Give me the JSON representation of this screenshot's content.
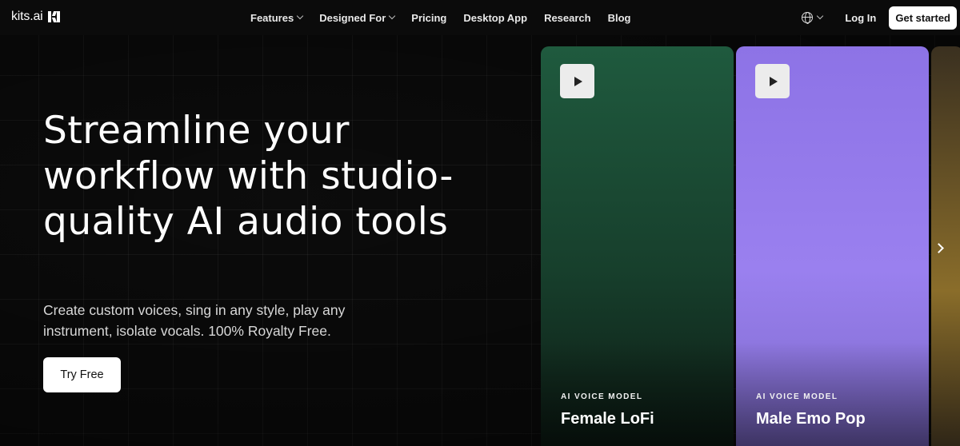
{
  "brand": {
    "name": "kits.ai"
  },
  "nav": {
    "links": [
      {
        "label": "Features",
        "dropdown": true
      },
      {
        "label": "Designed For",
        "dropdown": true
      },
      {
        "label": "Pricing",
        "dropdown": false
      },
      {
        "label": "Desktop App",
        "dropdown": false
      },
      {
        "label": "Research",
        "dropdown": false
      },
      {
        "label": "Blog",
        "dropdown": false
      }
    ],
    "language_icon": "globe-icon",
    "login_label": "Log In",
    "cta_label": "Get started"
  },
  "hero": {
    "title": "Streamline your workflow with studio-quality AI audio tools",
    "subtitle": "Create custom voices, sing in any style, play any instrument, isolate vocals. 100% Royalty Free.",
    "cta_label": "Try Free"
  },
  "cards": [
    {
      "kicker": "AI VOICE MODEL",
      "name": "Female LoFi",
      "background": "#1f5a3e"
    },
    {
      "kicker": "AI VOICE MODEL",
      "name": "Male Emo Pop",
      "background": "#9a80ef"
    }
  ],
  "colors": {
    "background": "#0b0b0b",
    "button": "#ffffff",
    "text": "#ffffff"
  }
}
